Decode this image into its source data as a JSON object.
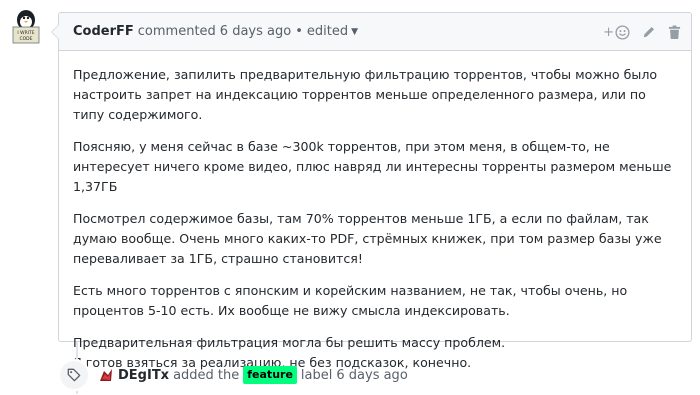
{
  "comment": {
    "author": "CoderFF",
    "action": "commented",
    "time": "6 days ago",
    "separator": "•",
    "edited": "edited",
    "avatar_sign_line1": "I WRITE",
    "avatar_sign_line2": "CODE",
    "add_reaction": "+",
    "paragraphs": [
      "Предложение, запилить предварительную фильтрацию торрентов, чтобы можно было настроить запрет на индексацию торрентов меньше определенного размера, или по типу содержимого.",
      "Поясняю, у меня сейчас в базе ~300k торрентов, при этом меня, в общем-то, не интересует ничего кроме видео, плюс навряд ли интересны торренты размером меньше 1,37ГБ",
      "Посмотрел содержимое базы, там 70% торрентов меньше 1ГБ, а если по файлам, так думаю вообще. Очень много каких-то PDF, стрёмных книжек, при том размер базы уже переваливает за 1ГБ, страшно становится!",
      "Есть много торрентов с японским и корейским названием, не так, чтобы очень, но процентов 5-10 есть. Их вообще не вижу смысла индексировать."
    ],
    "last_lines": [
      "Предварительная фильтрация могла бы решить массу проблем.",
      "Я готов взяться за реализацию, не без подсказок, конечно."
    ]
  },
  "event": {
    "actor": "DEgITx",
    "action": "added the",
    "label": "feature",
    "label_color": "#00ff7f",
    "suffix": "label",
    "time": "6 days ago"
  },
  "icons": {
    "avatar": "penguin-avatar",
    "reaction": "smiley-icon",
    "edit": "pencil-icon",
    "delete": "trash-icon",
    "event": "tag-icon"
  }
}
